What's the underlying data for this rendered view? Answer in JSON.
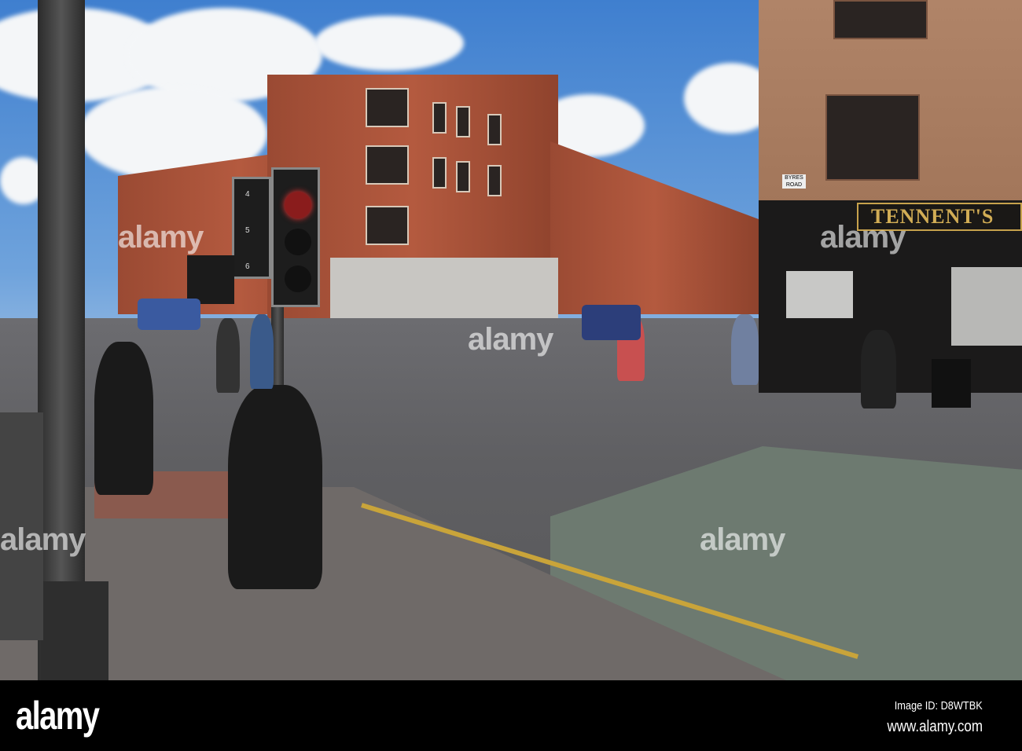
{
  "photo": {
    "shop_sign": "TENNENT'S",
    "street_sign": "BYRES ROAD",
    "signal_countdown": [
      "4",
      "5",
      "6"
    ],
    "watermark": "alamy"
  },
  "footer": {
    "logo": "alamy",
    "image_id": "Image ID: D8WTBK",
    "url": "www.alamy.com"
  }
}
